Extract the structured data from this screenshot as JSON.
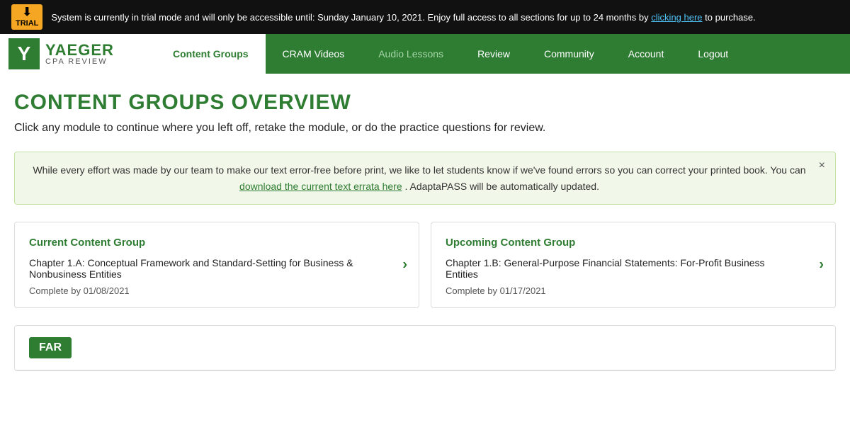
{
  "trial_banner": {
    "badge_line1": "▼",
    "badge_line2": "TRIAL",
    "message_before": "System is currently in trial mode and will only be accessible until: Sunday January 10, 2021. Enjoy full access to all sections for up to 24 months by",
    "link_text": "clicking here",
    "message_after": "to purchase."
  },
  "logo": {
    "letter": "Y",
    "name": "YAEGER",
    "sub": "CPA REVIEW"
  },
  "nav": {
    "items": [
      {
        "label": "Content Groups",
        "active": true
      },
      {
        "label": "CRAM Videos",
        "active": false
      },
      {
        "label": "Audio Lessons",
        "active": false,
        "muted": true
      },
      {
        "label": "Review",
        "active": false
      },
      {
        "label": "Community",
        "active": false
      },
      {
        "label": "Account",
        "active": false
      },
      {
        "label": "Logout",
        "active": false
      }
    ]
  },
  "page": {
    "title": "CONTENT GROUPS OVERVIEW",
    "subtitle": "Click any module to continue where you left off, retake the module, or do the practice questions for review."
  },
  "alert": {
    "text_before": "While every effort was made by our team to make our text error-free before print, we like to let students know if we've found errors so you can correct your printed book. You can",
    "link_text": "download the current text errata here",
    "text_after": ". AdaptaPASS will be automatically updated."
  },
  "current_card": {
    "title": "Current Content Group",
    "chapter": "Chapter 1.A: Conceptual Framework and Standard-Setting for Business & Nonbusiness Entities",
    "complete_by": "Complete by 01/08/2021",
    "arrow": "›"
  },
  "upcoming_card": {
    "title": "Upcoming Content Group",
    "chapter": "Chapter 1.B: General-Purpose Financial Statements: For-Profit Business Entities",
    "complete_by": "Complete by 01/17/2021",
    "arrow": "›"
  },
  "far_section": {
    "badge_label": "FAR"
  }
}
